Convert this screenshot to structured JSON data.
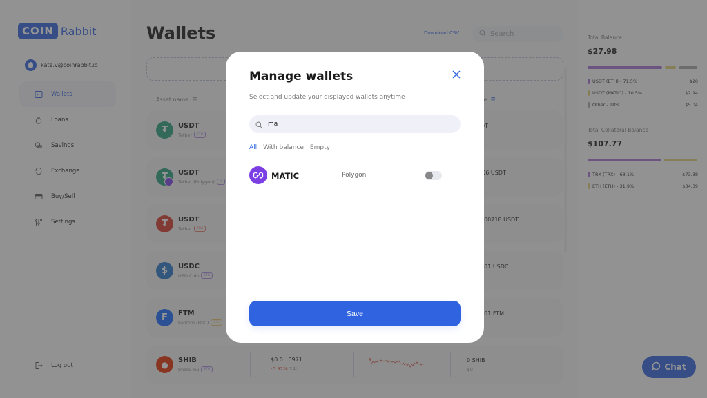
{
  "app": {
    "logo_box": "COIN",
    "logo_text": "Rabbit"
  },
  "user": {
    "email": "kate.v@coinrabbit.io"
  },
  "sidebar": {
    "items": [
      {
        "label": "Wallets",
        "icon": "wallet-icon",
        "active": true
      },
      {
        "label": "Loans",
        "icon": "money-bag-icon",
        "active": false
      },
      {
        "label": "Savings",
        "icon": "coins-icon",
        "active": false
      },
      {
        "label": "Exchange",
        "icon": "exchange-icon",
        "active": false
      },
      {
        "label": "Buy/Sell",
        "icon": "card-icon",
        "active": false
      },
      {
        "label": "Settings",
        "icon": "sliders-icon",
        "active": false
      }
    ],
    "logout": "Log out"
  },
  "main": {
    "title": "Wallets",
    "download_csv": "Download CSV",
    "search_placeholder": "Search",
    "columns": {
      "asset": "Asset name",
      "balance": "ce"
    },
    "rows": [
      {
        "symbol": "USDT",
        "name": "Tether",
        "network": "ETH",
        "balance": "DT",
        "icon_color": "#26a17b",
        "glyph": "₮"
      },
      {
        "symbol": "USDT",
        "name": "Tether (Polygon)",
        "network": "M",
        "balance": "'06 USDT",
        "icon_color": "#26a17b",
        "glyph": "₮"
      },
      {
        "symbol": "USDT",
        "name": "Tether",
        "network": "TRX",
        "balance": "000718 USDT",
        "icon_color": "#d63a2a",
        "glyph": "₮"
      },
      {
        "symbol": "USDC",
        "name": "USD Coin",
        "network": "ETH",
        "balance": "001 USDC",
        "icon_color": "#2775ca",
        "glyph": "$"
      },
      {
        "symbol": "FTM",
        "name": "Fantom (BSC)",
        "network": "BSC",
        "balance": "001 FTM",
        "icon_color": "#1969ff",
        "glyph": "F"
      },
      {
        "symbol": "SHIB",
        "name": "Shiba Inu",
        "network": "ETH",
        "price": "$0.0...0971",
        "change": "-0.92%",
        "change_period": "24h",
        "balance": "0 SHIB",
        "balance_usd": "$0",
        "icon_color": "#e42d04",
        "glyph": "🐕"
      }
    ]
  },
  "right_panel": {
    "total_balance": {
      "label": "Total Balance",
      "value": "$27.98",
      "segments": [
        {
          "label": "USDT (ETH) - 71.5%",
          "amount": "$20",
          "percent": 71.5,
          "color": "#a56fd8"
        },
        {
          "label": "USDT (MATIC) - 10.5%",
          "amount": "$2.94",
          "percent": 10.5,
          "color": "#e0cf76"
        },
        {
          "label": "Other - 18%",
          "amount": "$5.04",
          "percent": 18,
          "color": "#a7a7a7"
        }
      ]
    },
    "collateral": {
      "label": "Total Collateral Balance",
      "value": "$107.77",
      "segments": [
        {
          "label": "TRX (TRX) - 68.1%",
          "amount": "$73.38",
          "percent": 68.1,
          "color": "#a56fd8"
        },
        {
          "label": "ETH (ETH) - 31.9%",
          "amount": "$34.39",
          "percent": 31.9,
          "color": "#e0cf76"
        }
      ]
    }
  },
  "chat": {
    "label": "Chat"
  },
  "modal": {
    "title": "Manage wallets",
    "subtitle": "Select and update your displayed wallets anytime",
    "search_value": "ma",
    "filters": [
      "All",
      "With balance",
      "Empty"
    ],
    "active_filter": "All",
    "wallets": [
      {
        "symbol": "MATIC",
        "network": "Polygon",
        "enabled": false
      }
    ],
    "save_label": "Save"
  },
  "colors": {
    "accent": "#2f63e0",
    "matic": "#7b3fe4",
    "negative": "#e0533d"
  }
}
